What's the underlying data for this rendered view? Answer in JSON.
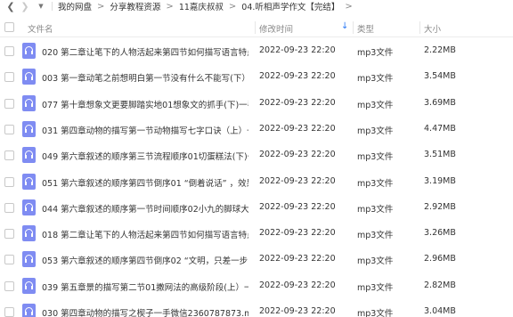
{
  "breadcrumb": [
    "我的网盘",
    "分享教程资源",
    "11嘉庆叔叔",
    "04.听相声学作文【完结】"
  ],
  "nav": {
    "back_icon": "chevron-left",
    "forward_icon": "chevron-right",
    "dropdown_icon": "caret-down"
  },
  "columns": {
    "name": "文件名",
    "modified": "修改时间",
    "type": "类型",
    "size": "大小"
  },
  "rows": [
    {
      "name": "020 第二章让笔下的人物活起来第四节如何描写语言特点...",
      "modified": "2022-09-23 22:20",
      "type": "mp3文件",
      "size": "2.22MB"
    },
    {
      "name": "003 第一章动笔之前想明白第一节没有什么不能写(下）...",
      "modified": "2022-09-23 22:20",
      "type": "mp3文件",
      "size": "3.54MB"
    },
    {
      "name": "077 第十章想象文更要脚踏实地01想象文的抓手(下)一手...",
      "modified": "2022-09-23 22:20",
      "type": "mp3文件",
      "size": "3.69MB"
    },
    {
      "name": "031 第四章动物的描写第一节动物描写七字口诀（上）一...",
      "modified": "2022-09-23 22:20",
      "type": "mp3文件",
      "size": "4.47MB"
    },
    {
      "name": "049 第六章叙述的顺序第三节流程顺序01切蛋糕法(下)一...",
      "modified": "2022-09-23 22:20",
      "type": "mp3文件",
      "size": "3.51MB"
    },
    {
      "name": "051 第六章叙述的顺序第四节倒序01 “倒着说话” ，效果...",
      "modified": "2022-09-23 22:20",
      "type": "mp3文件",
      "size": "3.19MB"
    },
    {
      "name": "044 第六章叙述的顺序第一节时间顺序02小九的脚球大战...",
      "modified": "2022-09-23 22:20",
      "type": "mp3文件",
      "size": "2.92MB"
    },
    {
      "name": "018 第二章让笔下的人物活起来第四节如何描写语言特点...",
      "modified": "2022-09-23 22:20",
      "type": "mp3文件",
      "size": "3.26MB"
    },
    {
      "name": "053 第六章叙述的顺序第四节倒序02 “文明，只差一步” ...",
      "modified": "2022-09-23 22:20",
      "type": "mp3文件",
      "size": "2.96MB"
    },
    {
      "name": "039 第五章景的描写第二节01撒网法的高级阶段(上）一...",
      "modified": "2022-09-23 22:20",
      "type": "mp3文件",
      "size": "2.82MB"
    },
    {
      "name": "030 第四章动物的描写之楔子一手微信2360787873.mp3",
      "modified": "2022-09-23 22:20",
      "type": "mp3文件",
      "size": "3.04MB"
    }
  ]
}
